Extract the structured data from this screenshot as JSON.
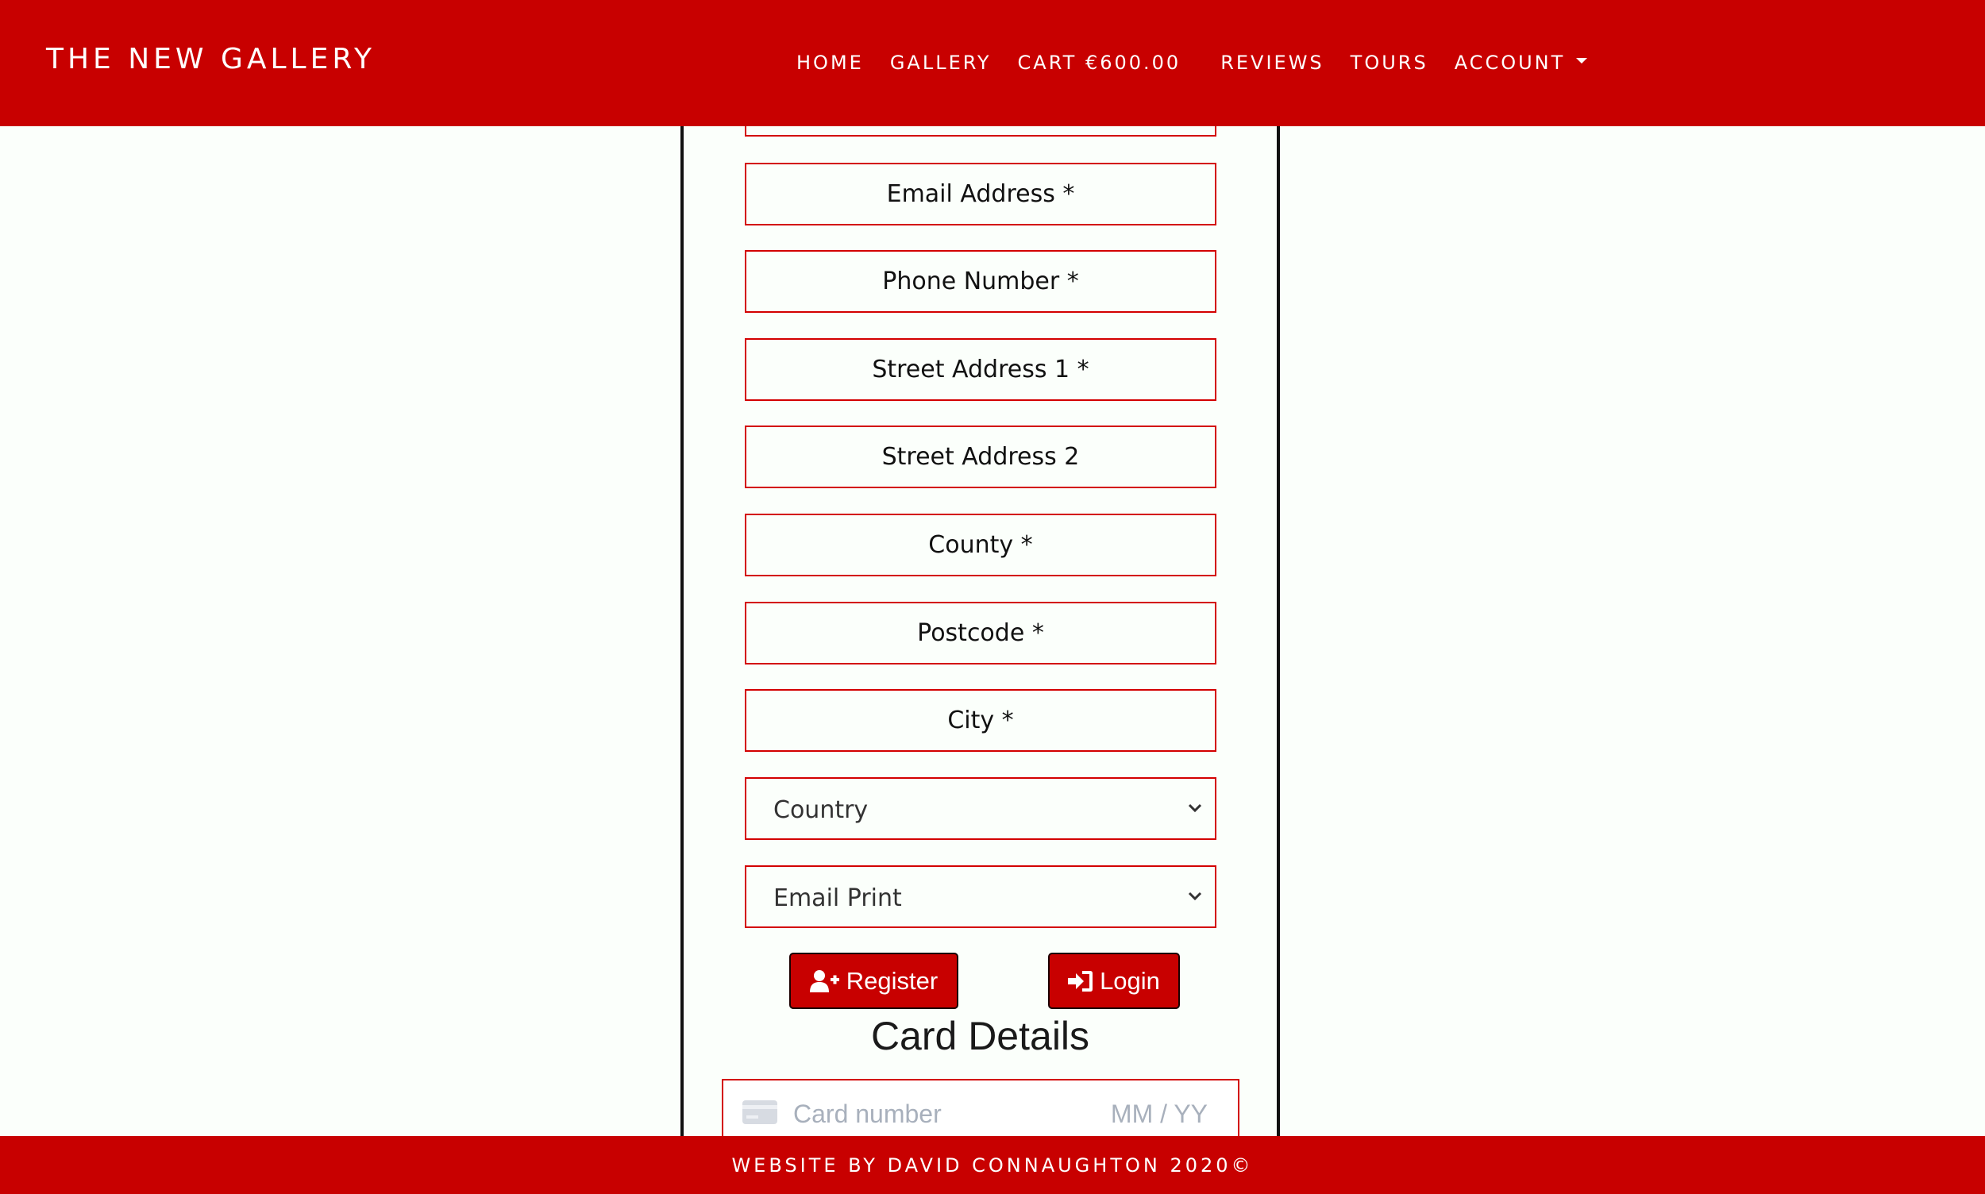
{
  "navbar": {
    "brand": "THE NEW GALLERY",
    "links": [
      {
        "label": "HOME"
      },
      {
        "label": "GALLERY"
      },
      {
        "label": "CART €600.00"
      },
      {
        "label": "REVIEWS"
      },
      {
        "label": "TOURS"
      },
      {
        "label": "ACCOUNT"
      }
    ]
  },
  "form": {
    "fields": [
      {
        "placeholder": "Email Address *"
      },
      {
        "placeholder": "Phone Number *"
      },
      {
        "placeholder": "Street Address 1 *"
      },
      {
        "placeholder": "Street Address 2"
      },
      {
        "placeholder": "County *"
      },
      {
        "placeholder": "Postcode *"
      },
      {
        "placeholder": "City *"
      }
    ],
    "selects": [
      {
        "value": "Country"
      },
      {
        "value": "Email Print"
      }
    ],
    "register_label": "Register",
    "login_label": "Login"
  },
  "card": {
    "heading": "Card Details",
    "number_placeholder": "Card number",
    "expiry_placeholder": "MM / YY"
  },
  "footer": {
    "text": "WEBSITE BY DAVID CONNAUGHTON 2020©"
  },
  "colors": {
    "brand_red": "#c80000",
    "field_border": "#d30000",
    "background": "#fbfffb",
    "placeholder_gray": "#a8b0bc"
  },
  "icons": [
    "caret-down-icon",
    "chevron-down-icon",
    "user-plus-icon",
    "sign-in-icon",
    "credit-card-icon"
  ]
}
